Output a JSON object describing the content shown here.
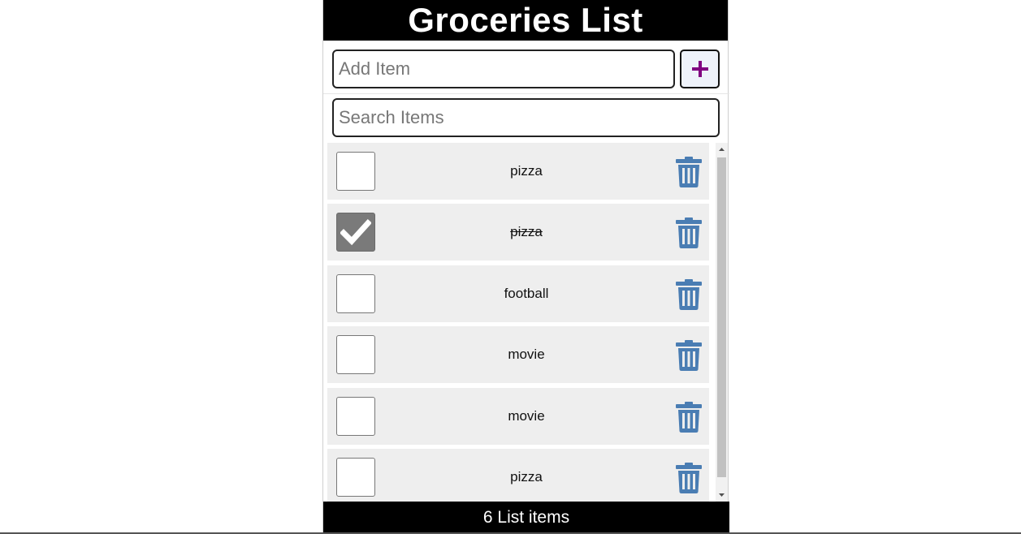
{
  "header": {
    "title": "Groceries List"
  },
  "add_item": {
    "placeholder": "Add Item",
    "value": "",
    "button_icon": "plus-icon"
  },
  "search": {
    "placeholder": "Search Items",
    "value": ""
  },
  "items": [
    {
      "label": "pizza",
      "checked": false
    },
    {
      "label": "pizza",
      "checked": true
    },
    {
      "label": "football",
      "checked": false
    },
    {
      "label": "movie",
      "checked": false
    },
    {
      "label": "movie",
      "checked": false
    },
    {
      "label": "pizza",
      "checked": false
    }
  ],
  "footer": {
    "text": "6 List items"
  },
  "colors": {
    "accent_plus": "#800080",
    "trash": "#4a7db3",
    "header_bg": "#000000",
    "item_bg": "#eeeeee",
    "checked_box": "#7a7a7a"
  }
}
